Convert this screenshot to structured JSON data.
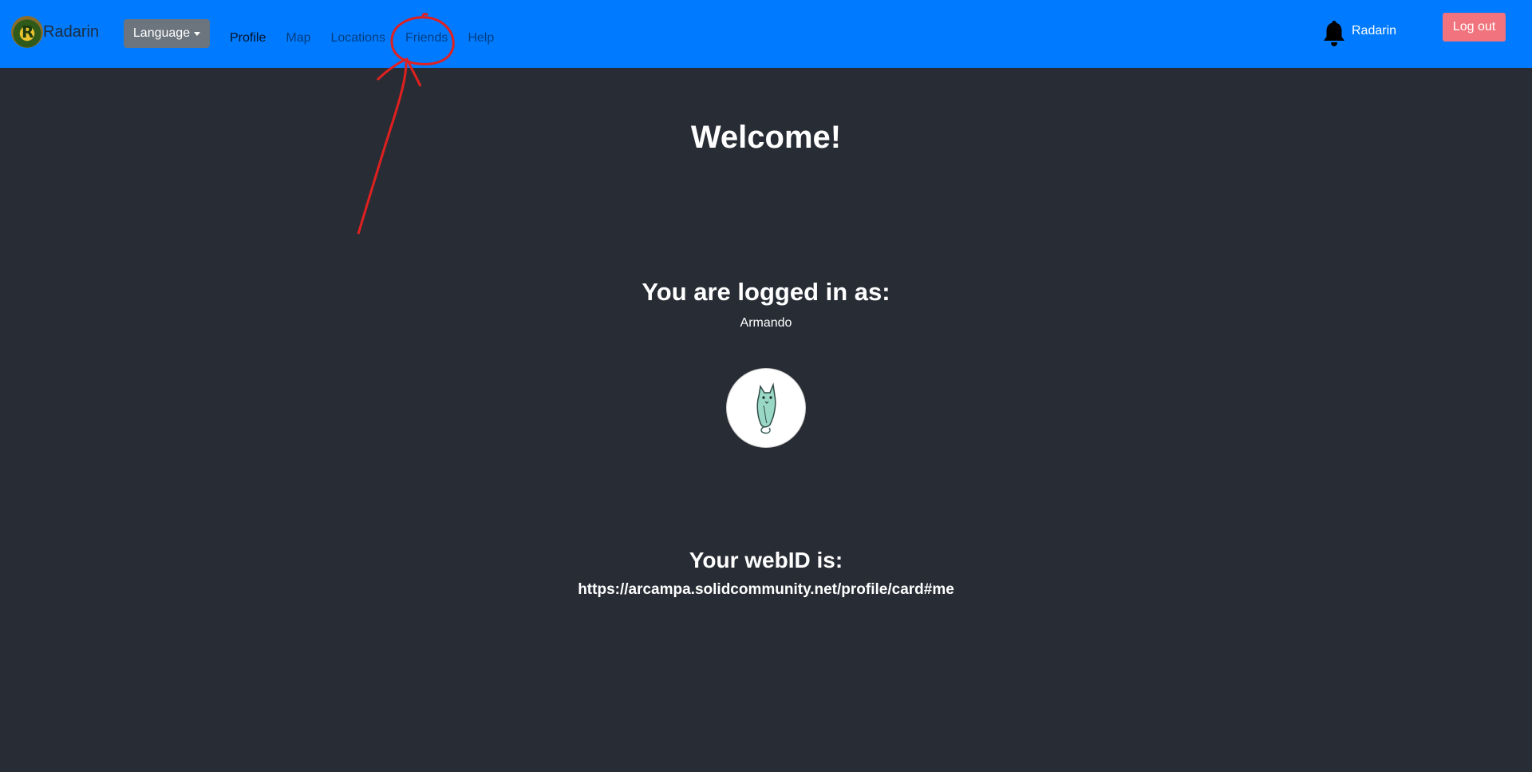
{
  "navbar": {
    "brand_name": "Radarin",
    "language_label": "Language",
    "links": [
      {
        "label": "Profile",
        "active": true
      },
      {
        "label": "Map",
        "active": false
      },
      {
        "label": "Locations",
        "active": false
      },
      {
        "label": "Friends",
        "active": false
      },
      {
        "label": "Help",
        "active": false
      }
    ],
    "user_name": "Radarin",
    "logout_label": "Log out",
    "icons": [
      "radarin-logo",
      "caret-down-icon",
      "bell-icon"
    ],
    "colors": {
      "background": "#007bff",
      "logout_button": "#f1737d",
      "language_button": "#6c757d"
    }
  },
  "main": {
    "welcome": "Welcome!",
    "logged_in_heading": "You are logged in as:",
    "username": "Armando",
    "avatar_icon": "cat-avatar",
    "webid_heading": "Your webID is:",
    "webid": "https://arcampa.solidcommunity.net/profile/card#me",
    "background": "#282c34"
  },
  "annotation": {
    "description_icon": "red-circle-and-arrow",
    "color": "#e02020"
  }
}
